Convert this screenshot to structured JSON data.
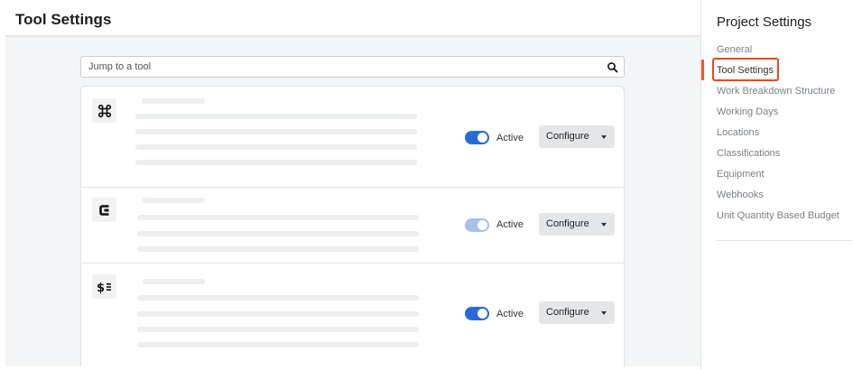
{
  "page": {
    "title": "Tool Settings"
  },
  "search": {
    "placeholder": "Jump to a tool",
    "icon": "search-icon"
  },
  "tools": [
    {
      "icon": "command-icon",
      "status": "Active",
      "enabled": true,
      "configure_label": "Configure"
    },
    {
      "icon": "c-logo-icon",
      "status": "Active",
      "enabled": false,
      "configure_label": "Configure"
    },
    {
      "icon": "dollar-list-icon",
      "status": "Active",
      "enabled": true,
      "configure_label": "Configure"
    }
  ],
  "sidebar": {
    "title": "Project Settings",
    "active_index": 1,
    "items": [
      {
        "label": "General"
      },
      {
        "label": "Tool Settings"
      },
      {
        "label": "Work Breakdown Structure"
      },
      {
        "label": "Working Days"
      },
      {
        "label": "Locations"
      },
      {
        "label": "Classifications"
      },
      {
        "label": "Equipment"
      },
      {
        "label": "Webhooks"
      },
      {
        "label": "Unit Quantity Based Budget"
      }
    ]
  },
  "colors": {
    "accent": "#2a6ad4",
    "highlight": "#e8471d",
    "active_bar": "#f05a28"
  }
}
